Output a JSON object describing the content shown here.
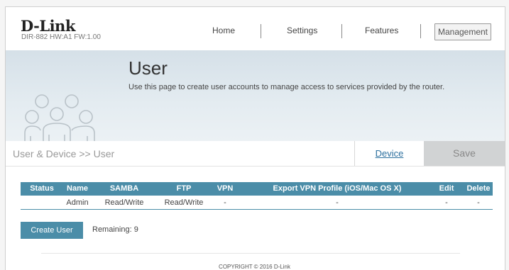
{
  "brand": {
    "logo": "D-Link",
    "model_info": "DIR-882 HW:A1 FW:1.00"
  },
  "nav": {
    "home": "Home",
    "settings": "Settings",
    "features": "Features",
    "management": "Management"
  },
  "hero": {
    "title": "User",
    "description": "Use this page to create user accounts to manage access to services provided by the router."
  },
  "breadcrumb": "User & Device >> User",
  "tabs": {
    "device": "Device",
    "save": "Save"
  },
  "table": {
    "headers": [
      "Status",
      "Name",
      "SAMBA",
      "FTP",
      "VPN",
      "Export VPN Profile (iOS/Mac OS X)",
      "Edit",
      "Delete"
    ],
    "rows": [
      {
        "status": "",
        "name": "Admin",
        "samba": "Read/Write",
        "ftp": "Read/Write",
        "vpn": "-",
        "export": "-",
        "edit": "-",
        "delete": "-"
      }
    ]
  },
  "actions": {
    "create_user": "Create User",
    "remaining": "Remaining: 9"
  },
  "footer": {
    "copyright": "COPYRIGHT © 2016 D-Link"
  },
  "colors": {
    "accent": "#4b8da8",
    "link": "#2b6f9e",
    "save_bg": "#d1d3d4"
  }
}
